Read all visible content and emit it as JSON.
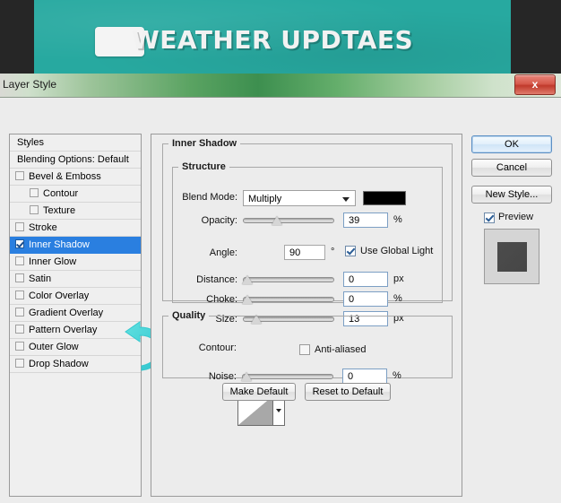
{
  "backdrop": {
    "banner_title": "WEATHER UPDTAES",
    "banner_color": "#27a9a0",
    "page_background": "#262626",
    "logo_name": "logo-placeholder"
  },
  "window": {
    "title": "Layer Style",
    "close_label": "x"
  },
  "styles_panel": {
    "header": "Styles",
    "blending_options": "Blending Options: Default",
    "items": [
      {
        "label": "Bevel & Emboss",
        "checked": false,
        "indent": false,
        "selected": false
      },
      {
        "label": "Contour",
        "checked": false,
        "indent": true,
        "selected": false
      },
      {
        "label": "Texture",
        "checked": false,
        "indent": true,
        "selected": false
      },
      {
        "label": "Stroke",
        "checked": false,
        "indent": false,
        "selected": false
      },
      {
        "label": "Inner Shadow",
        "checked": true,
        "indent": false,
        "selected": true
      },
      {
        "label": "Inner Glow",
        "checked": false,
        "indent": false,
        "selected": false
      },
      {
        "label": "Satin",
        "checked": false,
        "indent": false,
        "selected": false
      },
      {
        "label": "Color Overlay",
        "checked": false,
        "indent": false,
        "selected": false
      },
      {
        "label": "Gradient Overlay",
        "checked": false,
        "indent": false,
        "selected": false
      },
      {
        "label": "Pattern Overlay",
        "checked": false,
        "indent": false,
        "selected": false
      },
      {
        "label": "Outer Glow",
        "checked": false,
        "indent": false,
        "selected": false
      },
      {
        "label": "Drop Shadow",
        "checked": false,
        "indent": false,
        "selected": false
      }
    ],
    "selected_row_color": "#2a7fe0"
  },
  "inner_shadow": {
    "group_title": "Inner Shadow",
    "structure_title": "Structure",
    "blend_mode_label": "Blend Mode:",
    "blend_mode_value": "Multiply",
    "shadow_color": "#000000",
    "opacity_label": "Opacity:",
    "opacity_value": "39",
    "opacity_unit": "%",
    "angle_label": "Angle:",
    "angle_value": "90",
    "angle_unit": "°",
    "use_global_light_label": "Use Global Light",
    "use_global_light_checked": true,
    "distance_label": "Distance:",
    "distance_value": "0",
    "distance_unit": "px",
    "choke_label": "Choke:",
    "choke_value": "0",
    "choke_unit": "%",
    "size_label": "Size:",
    "size_value": "13",
    "size_unit": "px"
  },
  "quality": {
    "group_title": "Quality",
    "contour_label": "Contour:",
    "anti_aliased_label": "Anti-aliased",
    "anti_aliased_checked": false,
    "noise_label": "Noise:",
    "noise_value": "0",
    "noise_unit": "%"
  },
  "footer_buttons": {
    "make_default": "Make Default",
    "reset_to_default": "Reset to Default"
  },
  "side_buttons": {
    "ok": "OK",
    "cancel": "Cancel",
    "new_style": "New Style...",
    "preview_label": "Preview",
    "preview_checked": true
  },
  "annotation": {
    "arrow_color": "#3fd0d4",
    "points_at": "Inner Shadow"
  }
}
